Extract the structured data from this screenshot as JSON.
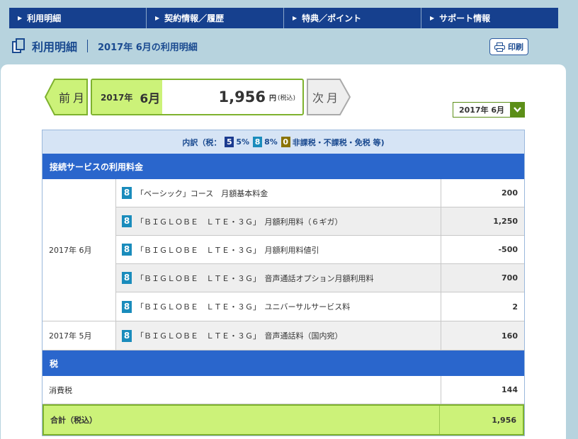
{
  "nav": {
    "items": [
      {
        "label": "利用明細"
      },
      {
        "label": "契約情報／履歴"
      },
      {
        "label": "特典／ポイント"
      },
      {
        "label": "サポート情報"
      }
    ]
  },
  "header": {
    "title": "利用明細",
    "subtitle": "2017年 6月の利用明細",
    "print_label": "印刷"
  },
  "summary": {
    "prev_label": "前月",
    "next_label": "次月",
    "year": "2017年",
    "month": "6月",
    "amount": "1,956",
    "unit": "円",
    "tax_note": "(税込)",
    "selected_month": "2017年 6月"
  },
  "legend": {
    "prefix": "内訳（税：",
    "badge5": "5",
    "text5": "5%",
    "badge8": "8",
    "text8": "8%",
    "badge0": "0",
    "text0": "非課税・不課税・免税 等)"
  },
  "sections": {
    "service_title": "接続サービスの利用料金",
    "tax_title": "税"
  },
  "groups": [
    {
      "period": "2017年 6月",
      "items": [
        {
          "badge": "8",
          "desc": "「ベーシック」コース　月額基本料金",
          "amount": "200"
        },
        {
          "badge": "8",
          "desc": "「ＢＩＧＬＯＢＥ　ＬＴＥ・３Ｇ」　月額利用料（６ギガ）",
          "amount": "1,250"
        },
        {
          "badge": "8",
          "desc": "「ＢＩＧＬＯＢＥ　ＬＴＥ・３Ｇ」　月額利用料値引",
          "amount": "-500"
        },
        {
          "badge": "8",
          "desc": "「ＢＩＧＬＯＢＥ　ＬＴＥ・３Ｇ」　音声通話オプション月額利用料",
          "amount": "700"
        },
        {
          "badge": "8",
          "desc": "「ＢＩＧＬＯＢＥ　ＬＴＥ・３Ｇ」　ユニバーサルサービス料",
          "amount": "2"
        }
      ]
    },
    {
      "period": "2017年 5月",
      "items": [
        {
          "badge": "8",
          "desc": "「ＢＩＧＬＯＢＥ　ＬＴＥ・３Ｇ」　音声通話料（国内宛）",
          "amount": "160"
        }
      ]
    }
  ],
  "tax": {
    "label": "消費税",
    "amount": "144"
  },
  "total": {
    "label": "合計（税込）",
    "amount": "1,956"
  },
  "colors": {
    "nav_bg": "#16408e",
    "accent_green": "#ccf279",
    "section_blue": "#2a66cc",
    "badge8": "#1a8cbc"
  }
}
